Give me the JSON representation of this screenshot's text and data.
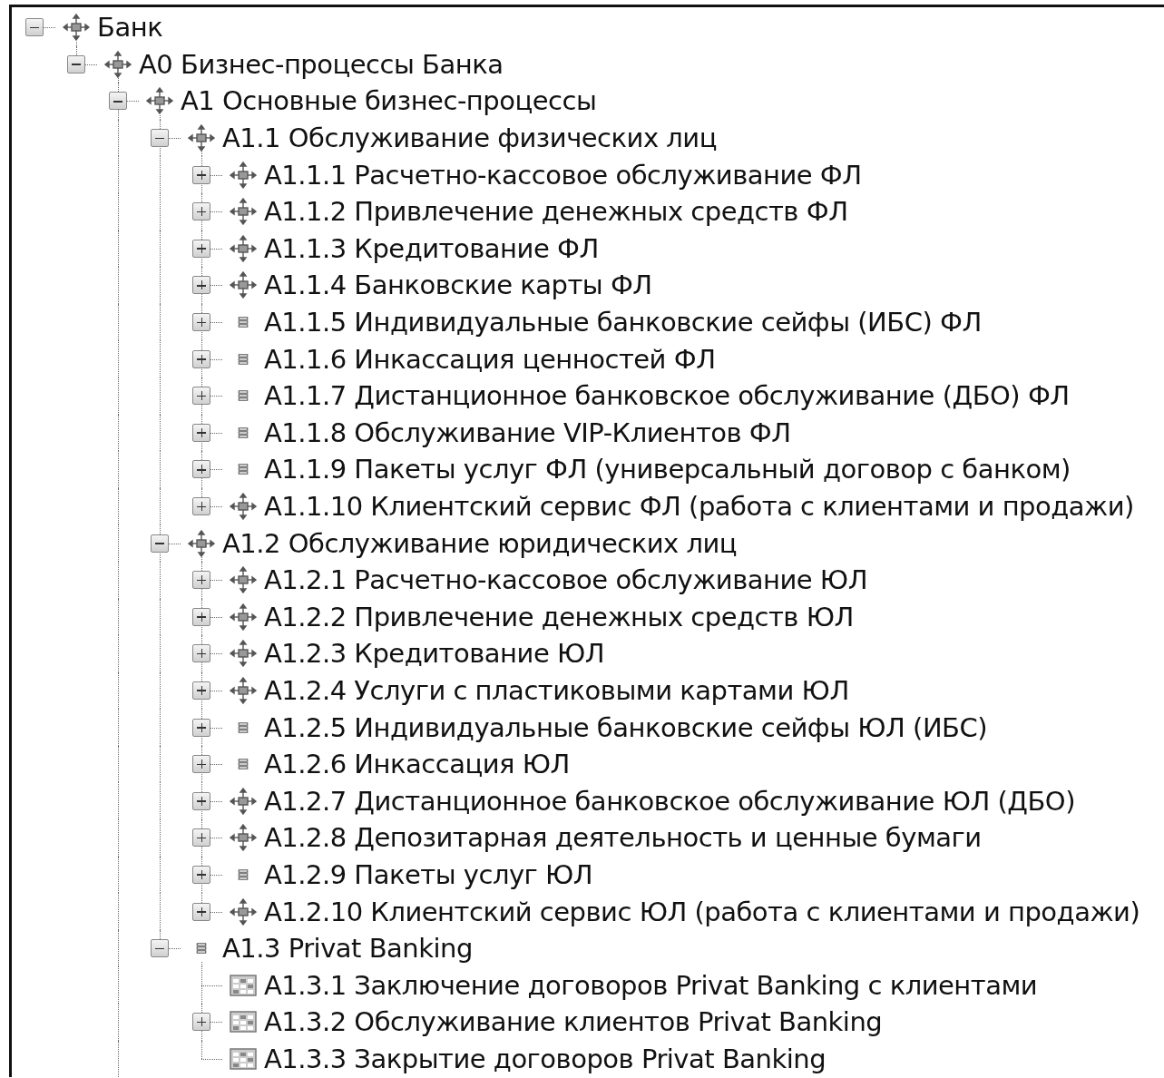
{
  "tree": [
    {
      "label": "Банк",
      "kind": "process",
      "expanded": true,
      "children": [
        {
          "label": "A0 Бизнес-процессы Банка",
          "kind": "process",
          "expanded": true,
          "children": [
            {
              "label": "A1 Основные бизнес-процессы",
              "kind": "process",
              "expanded": true,
              "more_siblings_below": true,
              "children": [
                {
                  "label": "A1.1 Обслуживание физических лиц",
                  "kind": "process",
                  "expanded": true,
                  "children": [
                    {
                      "label": "A1.1.1 Расчетно-кассовое обслуживание ФЛ",
                      "kind": "process",
                      "expanded": false
                    },
                    {
                      "label": "A1.1.2 Привлечение денежных средств ФЛ",
                      "kind": "process",
                      "expanded": false
                    },
                    {
                      "label": "A1.1.3 Кредитование ФЛ",
                      "kind": "process",
                      "expanded": false
                    },
                    {
                      "label": "A1.1.4 Банковские карты ФЛ",
                      "kind": "process",
                      "expanded": false
                    },
                    {
                      "label": "A1.1.5 Индивидуальные банковские сейфы (ИБС) ФЛ",
                      "kind": "chain",
                      "expanded": false
                    },
                    {
                      "label": "A1.1.6 Инкассация ценностей ФЛ",
                      "kind": "chain",
                      "expanded": false
                    },
                    {
                      "label": "A1.1.7 Дистанционное банковское обслуживание (ДБО) ФЛ",
                      "kind": "chain",
                      "expanded": false
                    },
                    {
                      "label": "A1.1.8 Обслуживание VIP-Клиентов ФЛ",
                      "kind": "chain",
                      "expanded": false
                    },
                    {
                      "label": "A1.1.9 Пакеты услуг ФЛ (универсальный договор с банком)",
                      "kind": "chain",
                      "expanded": false
                    },
                    {
                      "label": "A1.1.10 Клиентский сервис ФЛ (работа с клиентами и продажи)",
                      "kind": "process",
                      "expanded": false
                    }
                  ]
                },
                {
                  "label": "A1.2 Обслуживание юридических лиц",
                  "kind": "process",
                  "expanded": true,
                  "children": [
                    {
                      "label": "A1.2.1 Расчетно-кассовое обслуживание ЮЛ",
                      "kind": "process",
                      "expanded": false
                    },
                    {
                      "label": "A1.2.2 Привлечение денежных средств ЮЛ",
                      "kind": "process",
                      "expanded": false
                    },
                    {
                      "label": "A1.2.3 Кредитование ЮЛ",
                      "kind": "process",
                      "expanded": false
                    },
                    {
                      "label": "A1.2.4 Услуги с пластиковыми картами ЮЛ",
                      "kind": "process",
                      "expanded": false
                    },
                    {
                      "label": "A1.2.5 Индивидуальные банковские сейфы ЮЛ (ИБС)",
                      "kind": "chain",
                      "expanded": false
                    },
                    {
                      "label": "A1.2.6 Инкассация ЮЛ",
                      "kind": "chain",
                      "expanded": false
                    },
                    {
                      "label": "A1.2.7 Дистанционное банковское обслуживание ЮЛ (ДБО)",
                      "kind": "process",
                      "expanded": false
                    },
                    {
                      "label": "A1.2.8 Депозитарная деятельность и ценные бумаги",
                      "kind": "process",
                      "expanded": false
                    },
                    {
                      "label": "A1.2.9 Пакеты услуг ЮЛ",
                      "kind": "chain",
                      "expanded": false
                    },
                    {
                      "label": "A1.2.10 Клиентский сервис ЮЛ (работа с клиентами и продажи)",
                      "kind": "process",
                      "expanded": false
                    }
                  ]
                },
                {
                  "label": "A1.3 Privat Banking",
                  "kind": "chain",
                  "expanded": true,
                  "children": [
                    {
                      "label": "A1.3.1 Заключение договоров Privat Banking с клиентами",
                      "kind": "table"
                    },
                    {
                      "label": "A1.3.2 Обслуживание клиентов Privat Banking",
                      "kind": "table",
                      "expanded": false
                    },
                    {
                      "label": "A1.3.3 Закрытие договоров Privat Banking",
                      "kind": "table"
                    }
                  ]
                }
              ]
            }
          ]
        }
      ]
    }
  ]
}
